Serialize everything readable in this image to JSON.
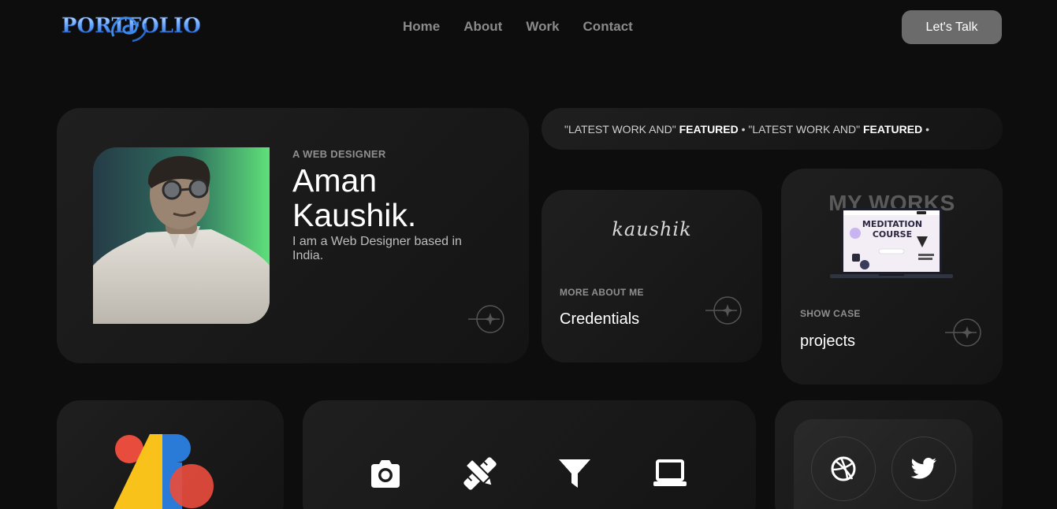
{
  "header": {
    "logo_text": "PORTFOLIO",
    "nav": [
      "Home",
      "About",
      "Work",
      "Contact"
    ],
    "cta_label": "Let's Talk"
  },
  "profile": {
    "eyebrow": "A WEB DESIGNER",
    "name": "Aman Kaushik.",
    "bio": "I am a Web Designer based in India."
  },
  "marquee": {
    "parts": [
      {
        "text": "\"LATEST WORK AND\" ",
        "bold": false
      },
      {
        "text": "FEATURED",
        "bold": true
      },
      {
        "text": " • \"LATEST WORK AND\" ",
        "bold": false
      },
      {
        "text": "FEATURED",
        "bold": true
      },
      {
        "text": " •",
        "bold": false
      }
    ]
  },
  "credentials": {
    "signature": "kaushik",
    "eyebrow": "MORE ABOUT ME",
    "title": "Credentials"
  },
  "works": {
    "heading": "MY WORKS",
    "screen_title_line1": "MEDITATION",
    "screen_title_line2": "COURSE",
    "eyebrow": "SHOW CASE",
    "title": "projects"
  },
  "services_icons": [
    "camera-icon",
    "pencil-ruler-icon",
    "filter-icon",
    "laptop-icon"
  ],
  "social_icons": [
    "dribbble-icon",
    "twitter-icon"
  ],
  "colors": {
    "background": "#0d0d0d",
    "card": "#1a1a1a",
    "cta": "#6b6b6b",
    "nav_text": "#8a8a8a",
    "photo_gradient_end": "#5fe07a",
    "brand_red": "#e84c3d",
    "brand_yellow": "#f9c21a",
    "brand_blue": "#2a7bd8"
  }
}
